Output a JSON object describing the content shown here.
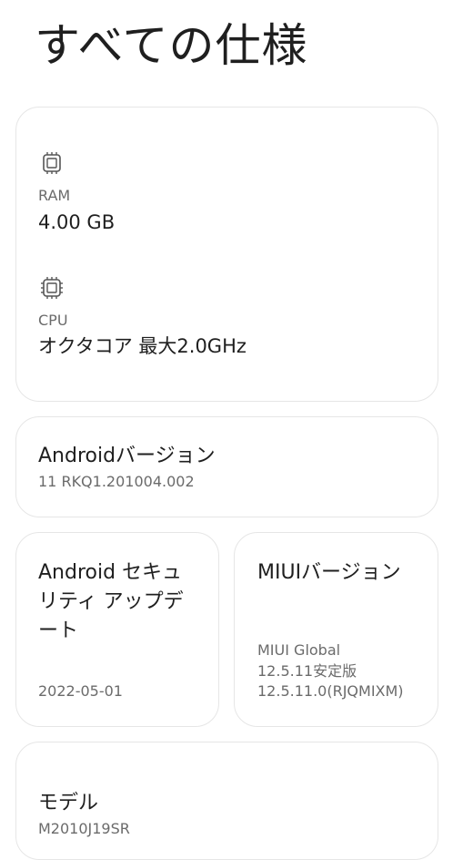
{
  "page": {
    "title": "すべての仕様"
  },
  "hardware": {
    "ram": {
      "icon": "memory-chip-icon",
      "label": "RAM",
      "value": "4.00 GB"
    },
    "cpu": {
      "icon": "processor-chip-icon",
      "label": "CPU",
      "value": "オクタコア 最大2.0GHz"
    }
  },
  "android_version": {
    "title": "Androidバージョン",
    "value": "11 RKQ1.201004.002"
  },
  "security_update": {
    "title_line1": "Android セキュ",
    "title_line2": "リティ アップデ",
    "title_line3": "ート",
    "value": "2022-05-01"
  },
  "miui_version": {
    "title": "MIUIバージョン",
    "line1": "MIUI Global",
    "line2": "12.5.11安定版",
    "line3": "12.5.11.0(RJQMIXM)"
  },
  "model": {
    "title": "モデル",
    "value": "M2010J19SR"
  },
  "colors": {
    "background": "#ffffff",
    "card_border": "#e6e6e6",
    "text_primary": "#1f1f1f",
    "text_secondary": "#6b6b6b"
  }
}
